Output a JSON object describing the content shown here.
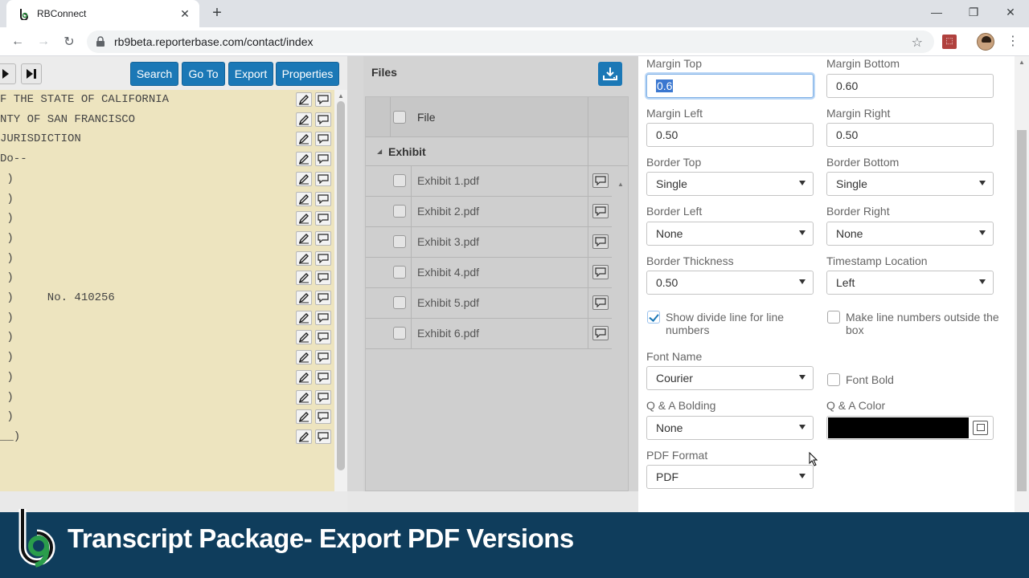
{
  "browser": {
    "tab_title": "RBConnect",
    "url": "rb9beta.reporterbase.com/contact/index"
  },
  "toolbar": {
    "search_label": "Search",
    "goto_label": "Go To",
    "export_label": "Export",
    "properties_label": "Properties"
  },
  "transcript": {
    "lines": [
      "F THE STATE OF CALIFORNIA",
      "NTY OF SAN FRANCISCO",
      "JURISDICTION",
      "Do--",
      " )",
      " )",
      " )",
      " )",
      " )",
      " )",
      " )     No. 410256",
      " )",
      " )",
      " )",
      " )",
      " )",
      " )",
      "__)"
    ]
  },
  "files": {
    "title": "Files",
    "column_file": "File",
    "group_label": "Exhibit",
    "items": [
      "Exhibit 1.pdf",
      "Exhibit 2.pdf",
      "Exhibit 3.pdf",
      "Exhibit 4.pdf",
      "Exhibit 5.pdf",
      "Exhibit 6.pdf"
    ]
  },
  "properties": {
    "margin_top_label": "Margin Top",
    "margin_top_value": "0.6",
    "margin_bottom_label": "Margin Bottom",
    "margin_bottom_value": "0.60",
    "margin_left_label": "Margin Left",
    "margin_left_value": "0.50",
    "margin_right_label": "Margin Right",
    "margin_right_value": "0.50",
    "border_top_label": "Border Top",
    "border_top_value": "Single",
    "border_bottom_label": "Border Bottom",
    "border_bottom_value": "Single",
    "border_left_label": "Border Left",
    "border_left_value": "None",
    "border_right_label": "Border Right",
    "border_right_value": "None",
    "border_thickness_label": "Border Thickness",
    "border_thickness_value": "0.50",
    "timestamp_location_label": "Timestamp Location",
    "timestamp_location_value": "Left",
    "show_divide_label": "Show divide line for line numbers",
    "show_divide_checked": true,
    "line_numbers_outside_label": "Make line numbers outside the box",
    "line_numbers_outside_checked": false,
    "font_name_label": "Font Name",
    "font_name_value": "Courier",
    "font_bold_label": "Font Bold",
    "font_bold_checked": false,
    "qa_bolding_label": "Q & A Bolding",
    "qa_bolding_value": "None",
    "qa_color_label": "Q & A Color",
    "qa_color_value": "#000000",
    "pdf_format_label": "PDF Format",
    "pdf_format_value": "PDF"
  },
  "video_title": "Transcript Package- Export PDF Versions",
  "colors": {
    "accent": "#1b78b6",
    "transcript_bg": "#ede4bf",
    "footer_bg": "#0f3d5c"
  }
}
